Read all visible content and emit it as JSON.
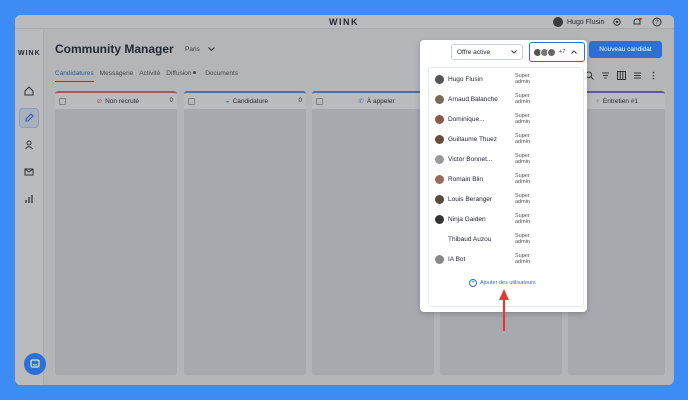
{
  "app": {
    "brand": "WINK",
    "side_brand": "WINK"
  },
  "user": {
    "name": "Hugo Flusin"
  },
  "page": {
    "title": "Community Manager",
    "location": "Paris"
  },
  "tabs": [
    "Candidatures",
    "Messagerie",
    "Activité",
    "Diffusion",
    "Documents"
  ],
  "columns": [
    {
      "label": "Non recruté",
      "count": "0",
      "color": "#e56a6a"
    },
    {
      "label": "Candidature",
      "count": "0",
      "color": "#5f93de"
    },
    {
      "label": "À appeler",
      "count": "",
      "color": "#5f93de"
    },
    {
      "label": "",
      "count": "",
      "color": "#8a8fa0"
    },
    {
      "label": "Entretien #1",
      "count": "",
      "color": "#7a6ed9"
    }
  ],
  "filters": {
    "offer": "Offre active",
    "extra_count": "+7"
  },
  "new_candidate_button": "Nouveau candidat",
  "users": [
    {
      "name": "Hugo Flusin",
      "role": "Super admin"
    },
    {
      "name": "Arnaud Balanche",
      "role": "Super admin"
    },
    {
      "name": "Dominique...",
      "role": "Super admin"
    },
    {
      "name": "Guillaume Thuez",
      "role": "Super admin"
    },
    {
      "name": "Victor Bonnet...",
      "role": "Super admin"
    },
    {
      "name": "Romain Blin",
      "role": "Super admin"
    },
    {
      "name": "Louis Beranger",
      "role": "Super admin"
    },
    {
      "name": "Ninja Gaiden",
      "role": "Super admin"
    },
    {
      "name": "Thibaud Auzou",
      "role": "Super admin"
    },
    {
      "name": "IA Bot",
      "role": "Super admin"
    }
  ],
  "add_users": "Ajouter des utilisateurs",
  "colors": {
    "accent": "#2d6fd6",
    "background": "#3d8bf5",
    "arrow": "#e53935"
  }
}
